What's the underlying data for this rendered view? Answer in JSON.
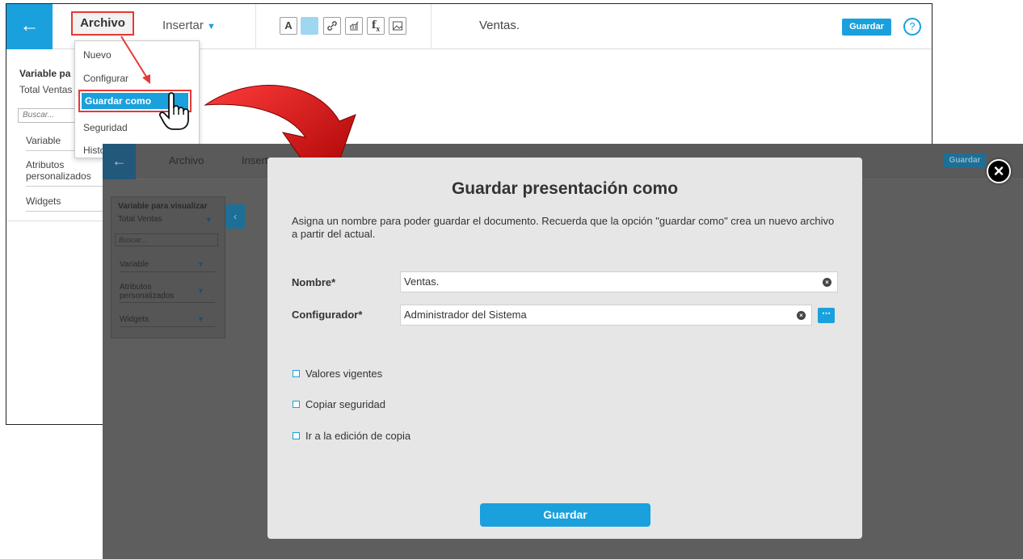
{
  "back_screen": {
    "menu": {
      "archivo": "Archivo",
      "insertar": "Insertar"
    },
    "toolbar_icons": [
      "text-format-icon",
      "color-swatch-icon",
      "link-icon",
      "chart-icon",
      "formula-icon",
      "image-icon"
    ],
    "text_icon_glyph": "A",
    "formula_icon_glyph": "f",
    "formula_icon_sub": "x",
    "document_title": "Ventas.",
    "save_label": "Guardar",
    "help_glyph": "?",
    "panel": {
      "variable_title": "Variable pa",
      "variable_value": "Total Ventas",
      "search_placeholder": "Buscar...",
      "sections": [
        "Variable",
        "Atributos personalizados",
        "Widgets"
      ]
    },
    "dropdown": {
      "items": [
        "Nuevo",
        "Configurar",
        "Guardar como",
        "Seguridad",
        "Histo"
      ]
    }
  },
  "front_screen": {
    "menu": {
      "archivo": "Archivo",
      "insertar": "Insert"
    },
    "document_title": "Ventas.",
    "save_label": "Guardar",
    "panel": {
      "variable_title": "Variable para visualizar",
      "variable_value": "Total Ventas",
      "search_placeholder": "Buscar...",
      "sections": [
        "Variable",
        "Atributos personalizados",
        "Widgets"
      ]
    }
  },
  "modal": {
    "title": "Guardar presentación como",
    "description": "Asigna un nombre para poder guardar el documento. Recuerda que la opción \"guardar como\" crea un nuevo archivo a partir del actual.",
    "fields": {
      "nombre_label": "Nombre*",
      "nombre_value": "Ventas.",
      "configurador_label": "Configurador*",
      "configurador_value": "Administrador del Sistema"
    },
    "checkboxes": [
      "Valores vigentes",
      "Copiar seguridad",
      "Ir a la edición de copia"
    ],
    "save_label": "Guardar"
  },
  "colors": {
    "accent": "#1aa0dd",
    "highlight": "#e53935",
    "arrow": "#c40000",
    "overlay": "#5e5e5e",
    "modal_bg": "#e6e6e6"
  }
}
